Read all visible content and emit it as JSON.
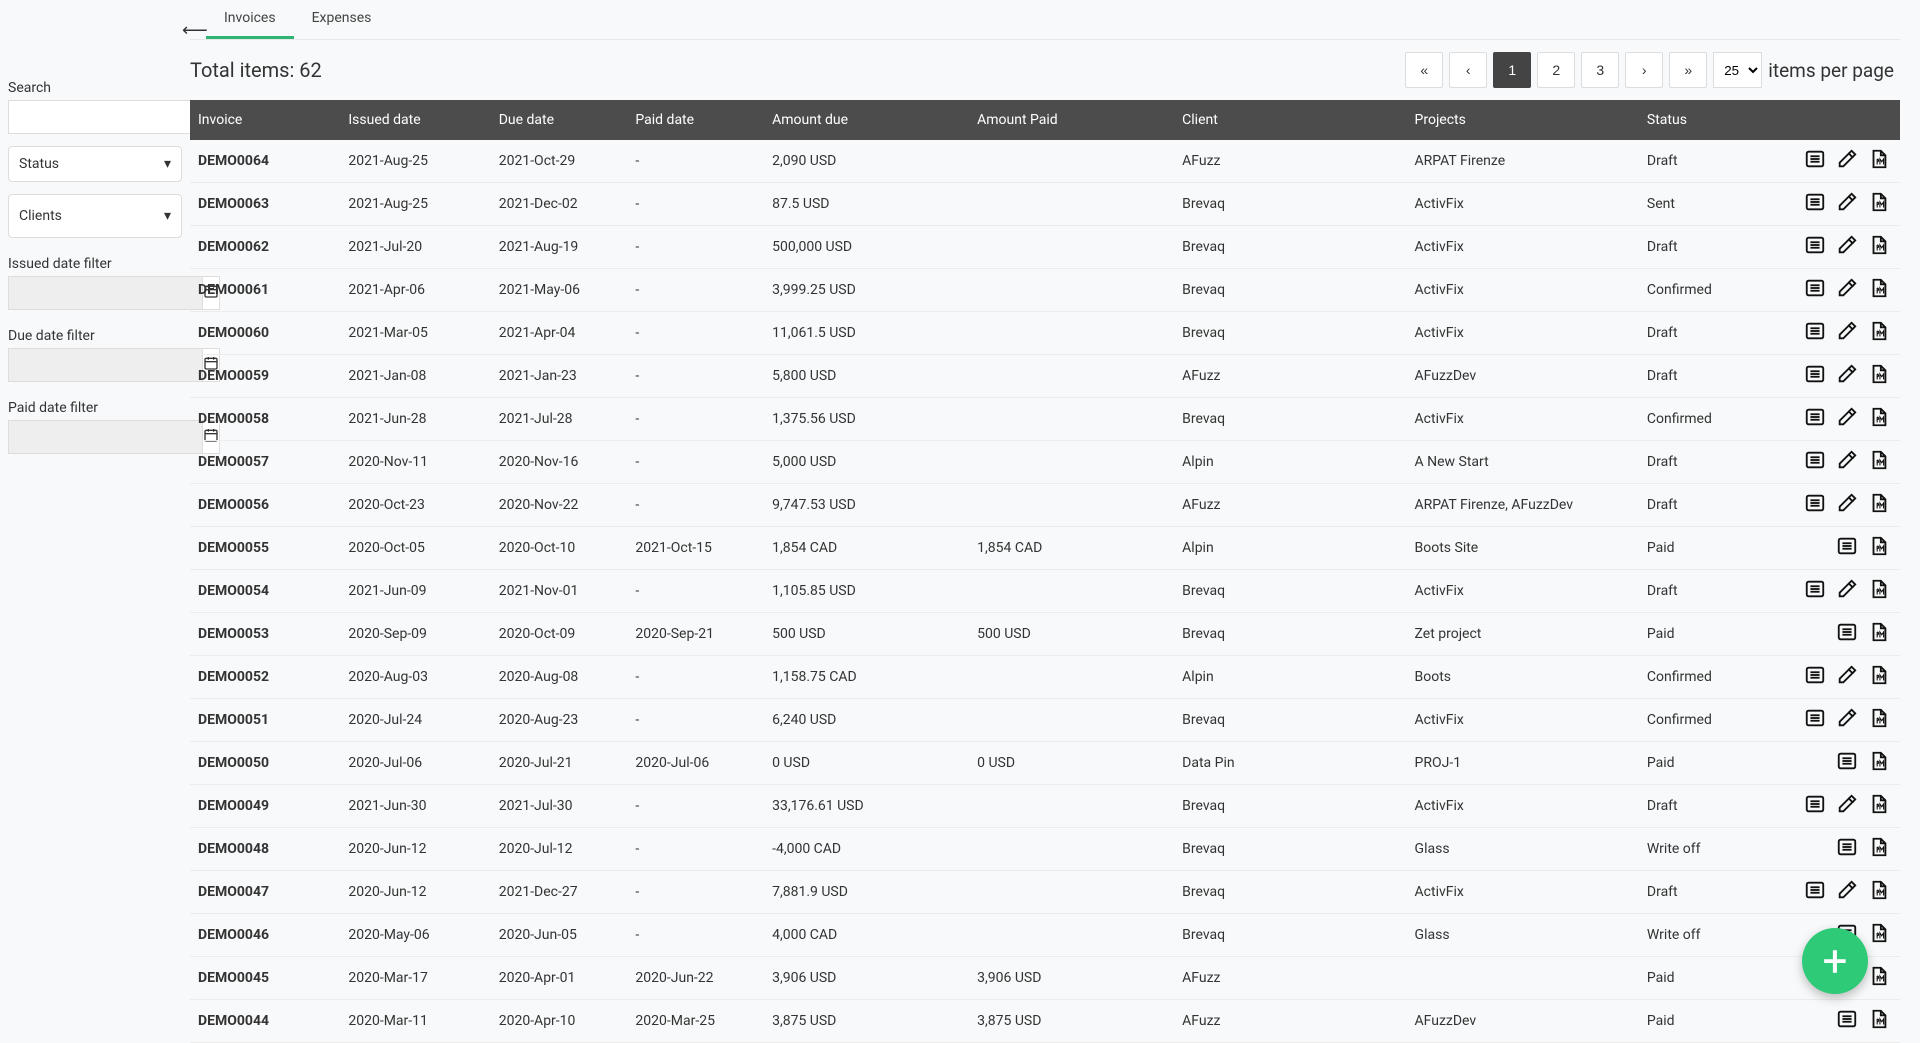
{
  "tabs": {
    "invoices": "Invoices",
    "expenses": "Expenses",
    "active": "invoices"
  },
  "toolbar": {
    "total_label": "Total items: 62",
    "pagination": {
      "first": "«",
      "prev": "‹",
      "pages": [
        "1",
        "2",
        "3"
      ],
      "active": "1",
      "next": "›",
      "last": "»"
    },
    "items_per_page_value": "25",
    "items_per_page_label": "items per page"
  },
  "filters": {
    "search_label": "Search",
    "status_label": "Status",
    "clients_label": "Clients",
    "issued_label": "Issued date filter",
    "due_label": "Due date filter",
    "paid_label": "Paid date filter"
  },
  "columns": {
    "invoice": "Invoice",
    "issued": "Issued date",
    "due": "Due date",
    "paid": "Paid date",
    "amount_due": "Amount due",
    "amount_paid": "Amount Paid",
    "client": "Client",
    "projects": "Projects",
    "status": "Status"
  },
  "rows": [
    {
      "id": "DEMO0064",
      "issued": "2021-Aug-25",
      "due": "2021-Oct-29",
      "paid": "-",
      "amount_due": "2,090 USD",
      "amount_paid": "",
      "client": "AFuzz",
      "projects": "ARPAT Firenze",
      "status": "Draft",
      "acts": [
        "view",
        "edit",
        "pdf"
      ]
    },
    {
      "id": "DEMO0063",
      "issued": "2021-Aug-25",
      "due": "2021-Dec-02",
      "paid": "-",
      "amount_due": "87.5 USD",
      "amount_paid": "",
      "client": "Brevaq",
      "projects": "ActivFix",
      "status": "Sent",
      "acts": [
        "view",
        "edit",
        "pdf"
      ]
    },
    {
      "id": "DEMO0062",
      "issued": "2021-Jul-20",
      "due": "2021-Aug-19",
      "paid": "-",
      "amount_due": "500,000 USD",
      "amount_paid": "",
      "client": "Brevaq",
      "projects": "ActivFix",
      "status": "Draft",
      "acts": [
        "view",
        "edit",
        "pdf"
      ]
    },
    {
      "id": "DEMO0061",
      "issued": "2021-Apr-06",
      "due": "2021-May-06",
      "paid": "-",
      "amount_due": "3,999.25 USD",
      "amount_paid": "",
      "client": "Brevaq",
      "projects": "ActivFix",
      "status": "Confirmed",
      "acts": [
        "view",
        "edit",
        "pdf"
      ]
    },
    {
      "id": "DEMO0060",
      "issued": "2021-Mar-05",
      "due": "2021-Apr-04",
      "paid": "-",
      "amount_due": "11,061.5 USD",
      "amount_paid": "",
      "client": "Brevaq",
      "projects": "ActivFix",
      "status": "Draft",
      "acts": [
        "view",
        "edit",
        "pdf"
      ]
    },
    {
      "id": "DEMO0059",
      "issued": "2021-Jan-08",
      "due": "2021-Jan-23",
      "paid": "-",
      "amount_due": "5,800 USD",
      "amount_paid": "",
      "client": "AFuzz",
      "projects": "AFuzzDev",
      "status": "Draft",
      "acts": [
        "view",
        "edit",
        "pdf"
      ]
    },
    {
      "id": "DEMO0058",
      "issued": "2021-Jun-28",
      "due": "2021-Jul-28",
      "paid": "-",
      "amount_due": "1,375.56 USD",
      "amount_paid": "",
      "client": "Brevaq",
      "projects": "ActivFix",
      "status": "Confirmed",
      "acts": [
        "view",
        "edit",
        "pdf"
      ]
    },
    {
      "id": "DEMO0057",
      "issued": "2020-Nov-11",
      "due": "2020-Nov-16",
      "paid": "-",
      "amount_due": "5,000 USD",
      "amount_paid": "",
      "client": "Alpin",
      "projects": "A New Start",
      "status": "Draft",
      "acts": [
        "view",
        "edit",
        "pdf"
      ]
    },
    {
      "id": "DEMO0056",
      "issued": "2020-Oct-23",
      "due": "2020-Nov-22",
      "paid": "-",
      "amount_due": "9,747.53 USD",
      "amount_paid": "",
      "client": "AFuzz",
      "projects": "ARPAT Firenze, AFuzzDev",
      "status": "Draft",
      "acts": [
        "view",
        "edit",
        "pdf"
      ]
    },
    {
      "id": "DEMO0055",
      "issued": "2020-Oct-05",
      "due": "2020-Oct-10",
      "paid": "2021-Oct-15",
      "amount_due": "1,854 CAD",
      "amount_paid": "1,854 CAD",
      "client": "Alpin",
      "projects": "Boots Site",
      "status": "Paid",
      "acts": [
        "view",
        "pdf"
      ]
    },
    {
      "id": "DEMO0054",
      "issued": "2021-Jun-09",
      "due": "2021-Nov-01",
      "paid": "-",
      "amount_due": "1,105.85 USD",
      "amount_paid": "",
      "client": "Brevaq",
      "projects": "ActivFix",
      "status": "Draft",
      "acts": [
        "view",
        "edit",
        "pdf"
      ]
    },
    {
      "id": "DEMO0053",
      "issued": "2020-Sep-09",
      "due": "2020-Oct-09",
      "paid": "2020-Sep-21",
      "amount_due": "500 USD",
      "amount_paid": "500 USD",
      "client": "Brevaq",
      "projects": "Zet project",
      "status": "Paid",
      "acts": [
        "view",
        "pdf"
      ]
    },
    {
      "id": "DEMO0052",
      "issued": "2020-Aug-03",
      "due": "2020-Aug-08",
      "paid": "-",
      "amount_due": "1,158.75 CAD",
      "amount_paid": "",
      "client": "Alpin",
      "projects": "Boots",
      "status": "Confirmed",
      "acts": [
        "view",
        "edit",
        "pdf"
      ]
    },
    {
      "id": "DEMO0051",
      "issued": "2020-Jul-24",
      "due": "2020-Aug-23",
      "paid": "-",
      "amount_due": "6,240 USD",
      "amount_paid": "",
      "client": "Brevaq",
      "projects": "ActivFix",
      "status": "Confirmed",
      "acts": [
        "view",
        "edit",
        "pdf"
      ]
    },
    {
      "id": "DEMO0050",
      "issued": "2020-Jul-06",
      "due": "2020-Jul-21",
      "paid": "2020-Jul-06",
      "amount_due": "0 USD",
      "amount_paid": "0 USD",
      "client": "Data Pin",
      "projects": "PROJ-1",
      "status": "Paid",
      "acts": [
        "view",
        "pdf"
      ]
    },
    {
      "id": "DEMO0049",
      "issued": "2021-Jun-30",
      "due": "2021-Jul-30",
      "paid": "-",
      "amount_due": "33,176.61 USD",
      "amount_paid": "",
      "client": "Brevaq",
      "projects": "ActivFix",
      "status": "Draft",
      "acts": [
        "view",
        "edit",
        "pdf"
      ]
    },
    {
      "id": "DEMO0048",
      "issued": "2020-Jun-12",
      "due": "2020-Jul-12",
      "paid": "-",
      "amount_due": "-4,000 CAD",
      "amount_paid": "",
      "client": "Brevaq",
      "projects": "Glass",
      "status": "Write off",
      "acts": [
        "view",
        "pdf"
      ]
    },
    {
      "id": "DEMO0047",
      "issued": "2020-Jun-12",
      "due": "2021-Dec-27",
      "paid": "-",
      "amount_due": "7,881.9 USD",
      "amount_paid": "",
      "client": "Brevaq",
      "projects": "ActivFix",
      "status": "Draft",
      "acts": [
        "view",
        "edit",
        "pdf"
      ]
    },
    {
      "id": "DEMO0046",
      "issued": "2020-May-06",
      "due": "2020-Jun-05",
      "paid": "-",
      "amount_due": "4,000 CAD",
      "amount_paid": "",
      "client": "Brevaq",
      "projects": "Glass",
      "status": "Write off",
      "acts": [
        "view",
        "pdf"
      ]
    },
    {
      "id": "DEMO0045",
      "issued": "2020-Mar-17",
      "due": "2020-Apr-01",
      "paid": "2020-Jun-22",
      "amount_due": "3,906 USD",
      "amount_paid": "3,906 USD",
      "client": "AFuzz",
      "projects": "",
      "status": "Paid",
      "acts": [
        "view",
        "pdf"
      ]
    },
    {
      "id": "DEMO0044",
      "issued": "2020-Mar-11",
      "due": "2020-Apr-10",
      "paid": "2020-Mar-25",
      "amount_due": "3,875 USD",
      "amount_paid": "3,875 USD",
      "client": "AFuzz",
      "projects": "AFuzzDev",
      "status": "Paid",
      "acts": [
        "view",
        "pdf"
      ]
    }
  ],
  "fab": "+"
}
